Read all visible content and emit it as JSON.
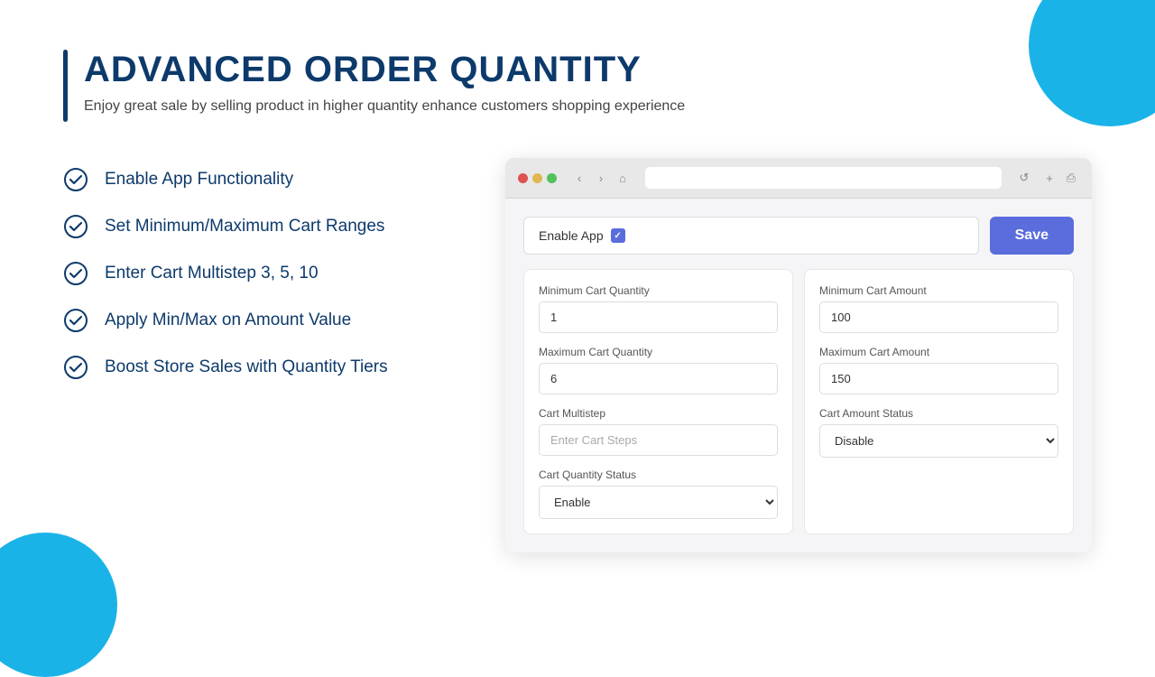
{
  "page": {
    "title": "ADVANCED ORDER QUANTITY",
    "subtitle": "Enjoy great sale by selling product in higher quantity enhance customers shopping experience"
  },
  "features": [
    {
      "id": "enable-app",
      "label": "Enable App Functionality"
    },
    {
      "id": "set-ranges",
      "label": "Set Minimum/Maximum Cart Ranges"
    },
    {
      "id": "enter-multistep",
      "label": "Enter Cart Multistep 3, 5, 10"
    },
    {
      "id": "apply-min-max",
      "label": "Apply Min/Max on Amount Value"
    },
    {
      "id": "boost-sales",
      "label": "Boost Store Sales with Quantity Tiers"
    }
  ],
  "browser": {
    "enable_app_label": "Enable App",
    "save_button": "Save",
    "left_panel": {
      "min_qty_label": "Minimum Cart Quantity",
      "min_qty_value": "1",
      "max_qty_label": "Maximum Cart Quantity",
      "max_qty_value": "6",
      "multistep_label": "Cart Multistep",
      "multistep_placeholder": "Enter Cart Steps",
      "qty_status_label": "Cart Quantity Status",
      "qty_status_value": "Enable",
      "qty_status_options": [
        "Enable",
        "Disable"
      ]
    },
    "right_panel": {
      "min_amount_label": "Minimum Cart Amount",
      "min_amount_value": "100",
      "max_amount_label": "Maximum Cart Amount",
      "max_amount_value": "150",
      "amount_status_label": "Cart Amount Status",
      "amount_status_value": "Disable",
      "amount_status_options": [
        "Enable",
        "Disable"
      ]
    }
  },
  "colors": {
    "primary": "#0d3a6b",
    "accent": "#5b6cdc",
    "teal": "#1ab3e8"
  }
}
